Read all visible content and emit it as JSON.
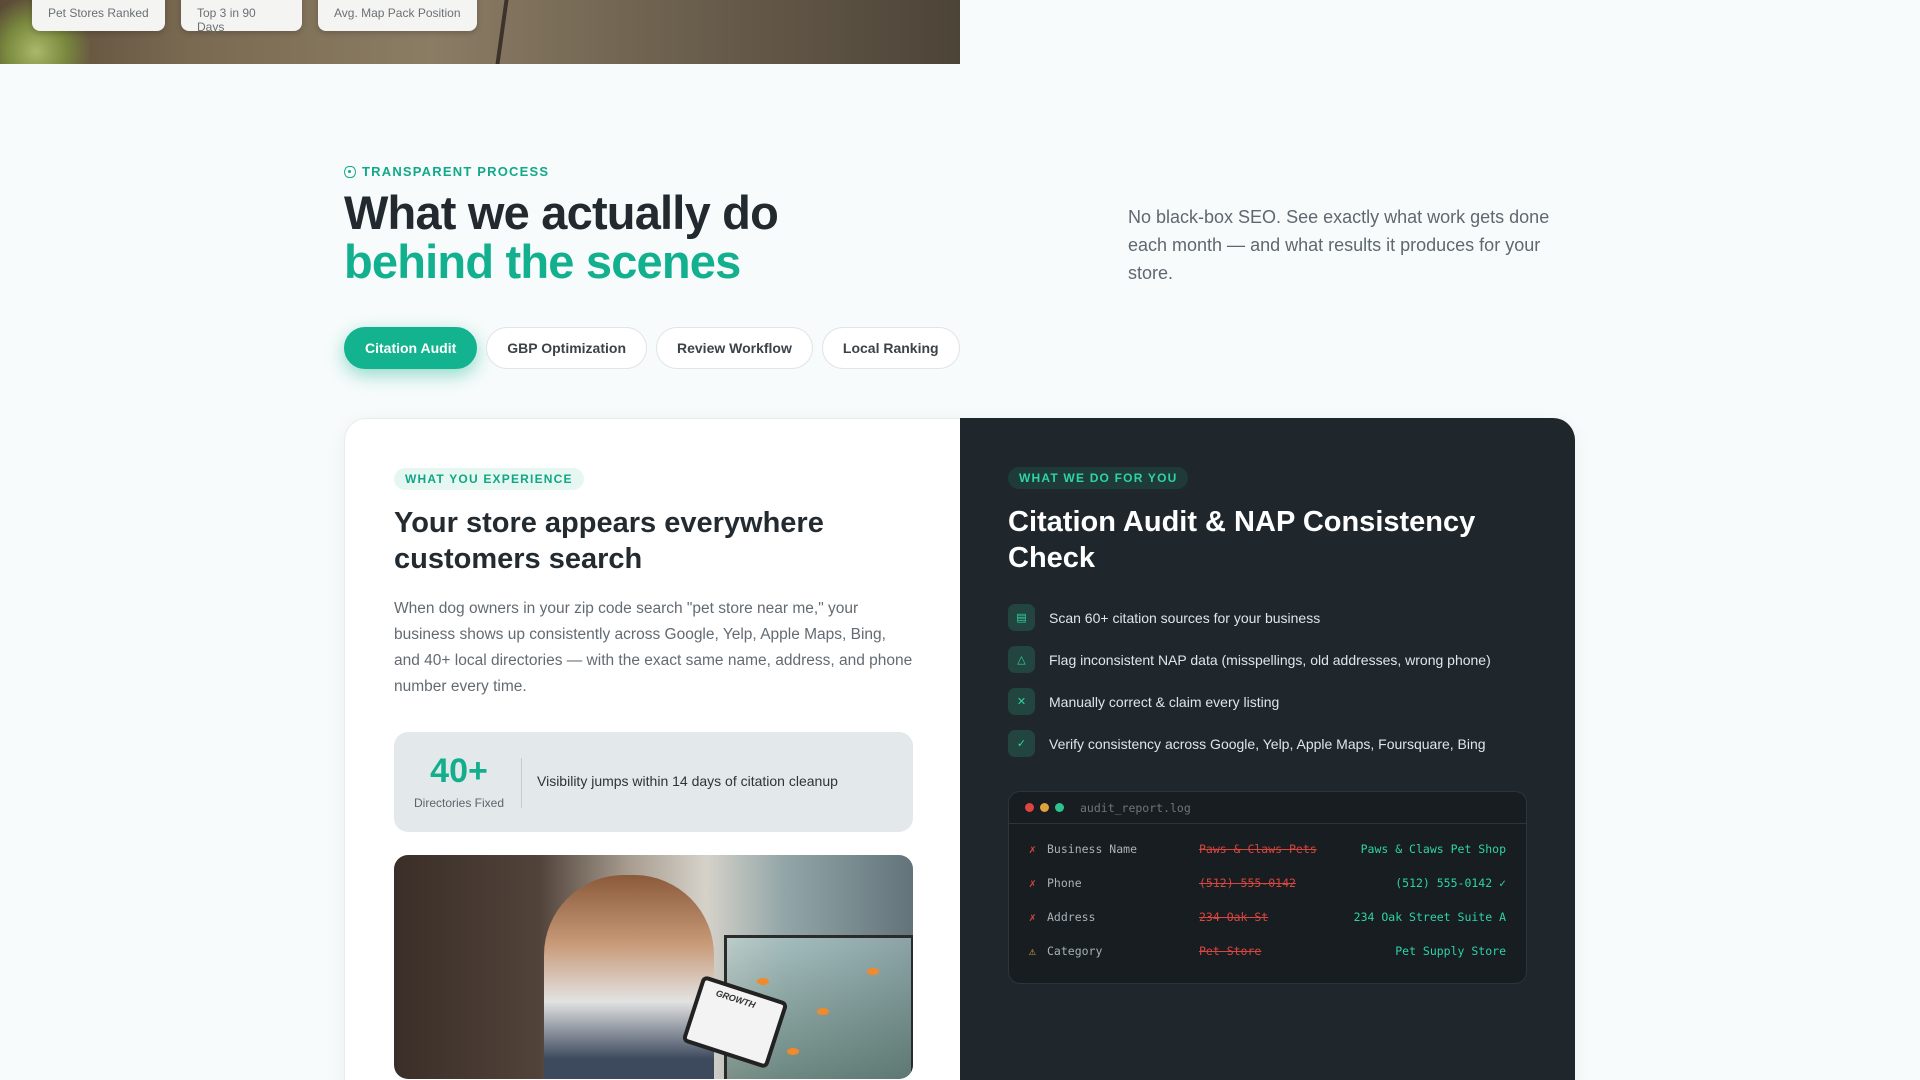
{
  "hero_stats": [
    {
      "value": "",
      "label": "Pet Stores Ranked"
    },
    {
      "value": "",
      "label": "Top 3 in 90 Days"
    },
    {
      "value": "",
      "label": "Avg. Map Pack Position"
    }
  ],
  "section": {
    "eyebrow": "TRANSPARENT PROCESS",
    "headline_line1": "What we actually do",
    "headline_line2": "behind the scenes",
    "intro": "No black-box SEO. See exactly what work gets done each month — and what results it produces for your store."
  },
  "tabs": [
    {
      "label": "Citation Audit",
      "active": true
    },
    {
      "label": "GBP Optimization",
      "active": false
    },
    {
      "label": "Review Workflow",
      "active": false
    },
    {
      "label": "Local Ranking",
      "active": false
    }
  ],
  "experience": {
    "pill": "WHAT YOU EXPERIENCE",
    "heading": "Your store appears everywhere customers search",
    "body": "When dog owners in your zip code search \"pet store near me,\" your business shows up consistently across Google, Yelp, Apple Maps, Bing, and 40+ local directories — with the exact same name, address, and phone number every time.",
    "metric": {
      "value": "40+",
      "label": "Directories Fixed",
      "text": "Visibility jumps within 14 days of citation cleanup"
    },
    "image_tablet_text": "GROWTH"
  },
  "service": {
    "pill": "WHAT WE DO FOR YOU",
    "heading": "Citation Audit & NAP Consistency Check",
    "steps": [
      {
        "icon": "document-icon",
        "glyph": "▤",
        "text": "Scan 60+ citation sources for your business"
      },
      {
        "icon": "warning-icon",
        "glyph": "△",
        "text": "Flag inconsistent NAP data (misspellings, old addresses, wrong phone)"
      },
      {
        "icon": "tools-icon",
        "glyph": "✕",
        "text": "Manually correct & claim every listing"
      },
      {
        "icon": "check-circle-icon",
        "glyph": "✓",
        "text": "Verify consistency across Google, Yelp, Apple Maps, Foursquare, Bing"
      }
    ],
    "terminal": {
      "title": "audit_report.log",
      "rows": [
        {
          "mark": "✗",
          "status": "error",
          "field": "Business Name",
          "old": "Paws & Claws Pets",
          "new": "Paws & Claws Pet Shop"
        },
        {
          "mark": "✗",
          "status": "error",
          "field": "Phone",
          "old": "(512) 555-0142",
          "new": "(512) 555-0142 ✓"
        },
        {
          "mark": "✗",
          "status": "error",
          "field": "Address",
          "old": "234 Oak St",
          "new": "234 Oak Street Suite A"
        },
        {
          "mark": "⚠",
          "status": "warning",
          "field": "Category",
          "old": "Pet Store",
          "new": "Pet Supply Store"
        }
      ]
    }
  },
  "colors": {
    "accent": "#13b38f",
    "dark_panel": "#1f272c",
    "error": "#d9453f",
    "warning": "#f2b233"
  }
}
